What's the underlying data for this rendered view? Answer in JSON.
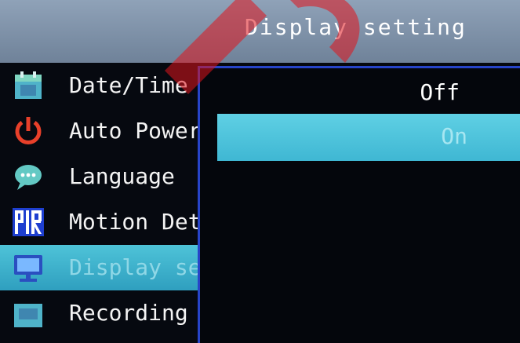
{
  "title": "Display setting",
  "menu": {
    "items": [
      {
        "label": "Date/Time",
        "icon": "calendar-icon"
      },
      {
        "label": "Auto Power Off",
        "icon": "power-icon"
      },
      {
        "label": "Language",
        "icon": "chat-bubble-icon"
      },
      {
        "label": "Motion Detection",
        "icon": "pir-icon"
      },
      {
        "label": "Display setting",
        "icon": "monitor-icon",
        "selected": true
      },
      {
        "label": "Recording",
        "icon": "recording-icon"
      }
    ]
  },
  "submenu": {
    "options": [
      {
        "label": "Off",
        "selected": false
      },
      {
        "label": "On",
        "selected": true
      }
    ]
  },
  "colors": {
    "accent_blue": "#2744c8",
    "highlight_cyan": "#4ec3d8",
    "title_bar": "#7f93aa",
    "watermark_red": "#e0141c"
  }
}
